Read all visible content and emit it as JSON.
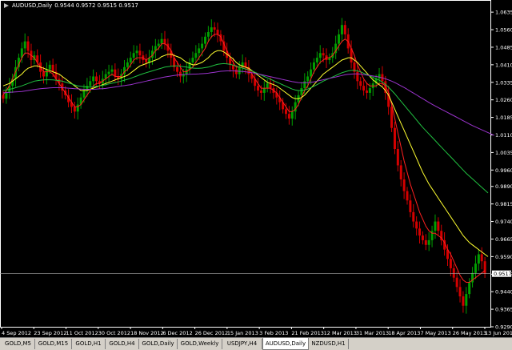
{
  "header": {
    "symbol": "AUDUSD,Daily",
    "ohlc": "0.9544 0.9572 0.9515 0.9517"
  },
  "colors": {
    "background": "#000000",
    "grid": "#4a4a4a",
    "axis": "#ffffff",
    "bull_candle": "#00a000",
    "bear_candle": "#d40000",
    "ma_fast": "#ff2020",
    "ma_mid": "#ffff30",
    "ma_slow": "#20c040",
    "ma_slowest": "#9a33cc",
    "price_line": "#aaaaaa"
  },
  "chart_data": {
    "type": "candlestick",
    "symbol": "AUDUSD",
    "timeframe": "Daily",
    "current_price": 0.9517,
    "current_price_label": "0.9517",
    "y_range": [
      0.929,
      1.068
    ],
    "y_ticks": [
      "1.0635",
      "1.0560",
      "1.0485",
      "1.0410",
      "1.0335",
      "1.0260",
      "1.0185",
      "1.0110",
      "1.0035",
      "0.9960",
      "0.9890",
      "0.9815",
      "0.9740",
      "0.9665",
      "0.9590",
      "0.9515",
      "0.9440",
      "0.9365",
      "0.9290"
    ],
    "x_ticks": [
      "4 Sep 2012",
      "23 Sep 2012",
      "11 Oct 2012",
      "30 Oct 2012",
      "18 Nov 2012",
      "6 Dec 2012",
      "26 Dec 2012",
      "15 Jan 2013",
      "3 Feb 2013",
      "21 Feb 2013",
      "12 Mar 2013",
      "31 Mar 2013",
      "18 Apr 2013",
      "7 May 2013",
      "26 May 2013",
      "13 Jun 2013"
    ],
    "closes": [
      1.0265,
      1.029,
      1.032,
      1.035,
      1.04,
      1.044,
      1.048,
      1.051,
      1.047,
      1.043,
      1.045,
      1.042,
      1.038,
      1.036,
      1.039,
      1.041,
      1.038,
      1.035,
      1.033,
      1.03,
      1.028,
      1.025,
      1.023,
      1.021,
      1.024,
      1.027,
      1.03,
      1.032,
      1.034,
      1.036,
      1.034,
      1.033,
      1.035,
      1.037,
      1.038,
      1.039,
      1.036,
      1.035,
      1.037,
      1.04,
      1.042,
      1.044,
      1.046,
      1.047,
      1.045,
      1.043,
      1.042,
      1.044,
      1.047,
      1.049,
      1.05,
      1.052,
      1.05,
      1.047,
      1.044,
      1.04,
      1.038,
      1.036,
      1.037,
      1.039,
      1.042,
      1.044,
      1.046,
      1.048,
      1.05,
      1.053,
      1.055,
      1.057,
      1.056,
      1.054,
      1.051,
      1.047,
      1.044,
      1.041,
      1.039,
      1.037,
      1.04,
      1.042,
      1.04,
      1.037,
      1.035,
      1.032,
      1.03,
      1.029,
      1.031,
      1.033,
      1.031,
      1.029,
      1.027,
      1.025,
      1.022,
      1.02,
      1.018,
      1.021,
      1.025,
      1.028,
      1.031,
      1.034,
      1.036,
      1.039,
      1.042,
      1.044,
      1.046,
      1.045,
      1.043,
      1.044,
      1.046,
      1.05,
      1.054,
      1.058,
      1.054,
      1.048,
      1.042,
      1.038,
      1.034,
      1.032,
      1.03,
      1.029,
      1.031,
      1.033,
      1.035,
      1.037,
      1.034,
      1.029,
      1.023,
      1.014,
      1.005,
      0.998,
      0.992,
      0.987,
      0.983,
      0.978,
      0.974,
      0.971,
      0.968,
      0.966,
      0.964,
      0.966,
      0.97,
      0.974,
      0.97,
      0.966,
      0.962,
      0.958,
      0.954,
      0.95,
      0.946,
      0.942,
      0.938,
      0.943,
      0.948,
      0.952,
      0.956,
      0.96,
      0.957,
      0.9517
    ],
    "series": [
      {
        "name": "MA fast",
        "values": [
          1.028,
          1.03,
          1.032,
          1.035,
          1.038,
          1.041,
          1.044,
          1.046,
          1.046,
          1.045,
          1.044,
          1.042,
          1.04,
          1.038,
          1.038,
          1.038,
          1.037,
          1.035,
          1.033,
          1.031,
          1.029,
          1.027,
          1.025,
          1.023,
          1.023,
          1.024,
          1.026,
          1.028,
          1.03,
          1.032,
          1.033,
          1.033,
          1.034,
          1.035,
          1.036,
          1.037,
          1.036,
          1.036,
          1.036,
          1.038,
          1.039,
          1.041,
          1.043,
          1.044,
          1.044,
          1.044,
          1.043,
          1.044,
          1.045,
          1.047,
          1.048,
          1.05,
          1.05,
          1.049,
          1.047,
          1.044,
          1.042,
          1.04,
          1.038,
          1.038,
          1.039,
          1.04,
          1.042,
          1.044,
          1.046,
          1.048,
          1.051,
          1.053,
          1.054,
          1.054,
          1.053,
          1.05,
          1.047,
          1.044,
          1.042,
          1.04,
          1.04,
          1.04,
          1.04,
          1.039,
          1.037,
          1.035,
          1.033,
          1.031,
          1.031,
          1.031,
          1.031,
          1.03,
          1.029,
          1.027,
          1.025,
          1.023,
          1.021,
          1.021,
          1.022,
          1.024,
          1.027,
          1.03,
          1.032,
          1.035,
          1.038,
          1.04,
          1.042,
          1.043,
          1.044,
          1.044,
          1.045,
          1.047,
          1.049,
          1.051,
          1.052,
          1.051,
          1.048,
          1.045,
          1.041,
          1.038,
          1.035,
          1.033,
          1.032,
          1.032,
          1.032,
          1.033,
          1.033,
          1.032,
          1.029,
          1.024,
          1.018,
          1.012,
          1.006,
          1.0,
          0.995,
          0.99,
          0.986,
          0.982,
          0.978,
          0.975,
          0.972,
          0.97,
          0.969,
          0.969,
          0.968,
          0.967,
          0.965,
          0.962,
          0.96,
          0.957,
          0.954,
          0.951,
          0.949,
          0.948,
          0.948,
          0.949,
          0.95,
          0.951,
          0.952,
          0.953
        ]
      },
      {
        "name": "MA mid",
        "values": [
          1.032,
          1.0325,
          1.033,
          1.034,
          1.035,
          1.036,
          1.037,
          1.0385,
          1.0395,
          1.04,
          1.0405,
          1.0405,
          1.04,
          1.0395,
          1.039,
          1.0385,
          1.038,
          1.0375,
          1.037,
          1.036,
          1.035,
          1.034,
          1.033,
          1.032,
          1.031,
          1.03,
          1.03,
          1.03,
          1.0305,
          1.031,
          1.0315,
          1.032,
          1.0325,
          1.033,
          1.0335,
          1.034,
          1.0345,
          1.035,
          1.0355,
          1.036,
          1.0365,
          1.0375,
          1.0385,
          1.0395,
          1.0405,
          1.041,
          1.0415,
          1.042,
          1.0425,
          1.043,
          1.0435,
          1.0445,
          1.045,
          1.0455,
          1.0455,
          1.045,
          1.0445,
          1.044,
          1.043,
          1.042,
          1.0415,
          1.041,
          1.041,
          1.0415,
          1.042,
          1.043,
          1.044,
          1.0455,
          1.0465,
          1.047,
          1.047,
          1.0465,
          1.0455,
          1.0445,
          1.0435,
          1.042,
          1.041,
          1.0405,
          1.04,
          1.0395,
          1.0385,
          1.0375,
          1.0365,
          1.0355,
          1.0345,
          1.0335,
          1.033,
          1.0325,
          1.032,
          1.031,
          1.03,
          1.029,
          1.028,
          1.027,
          1.0265,
          1.0265,
          1.027,
          1.028,
          1.0295,
          1.031,
          1.0325,
          1.034,
          1.0355,
          1.037,
          1.038,
          1.039,
          1.04,
          1.041,
          1.042,
          1.043,
          1.0435,
          1.044,
          1.044,
          1.043,
          1.042,
          1.0405,
          1.039,
          1.0375,
          1.036,
          1.0345,
          1.0335,
          1.0325,
          1.0315,
          1.03,
          1.028,
          1.025,
          1.022,
          1.019,
          1.016,
          1.013,
          1.01,
          1.007,
          1.004,
          1.001,
          0.998,
          0.995,
          0.9925,
          0.99,
          0.988,
          0.986,
          0.984,
          0.982,
          0.98,
          0.978,
          0.976,
          0.974,
          0.972,
          0.97,
          0.968,
          0.9665,
          0.965,
          0.964,
          0.963,
          0.962,
          0.961,
          0.96,
          0.959
        ]
      },
      {
        "name": "MA slow",
        "values": [
          1.03,
          1.0302,
          1.0305,
          1.0308,
          1.0312,
          1.0316,
          1.032,
          1.0325,
          1.033,
          1.0335,
          1.034,
          1.0342,
          1.0344,
          1.0345,
          1.0346,
          1.0346,
          1.0345,
          1.0344,
          1.0342,
          1.034,
          1.0336,
          1.0332,
          1.0328,
          1.0324,
          1.032,
          1.0318,
          1.0316,
          1.0315,
          1.0315,
          1.0316,
          1.0318,
          1.032,
          1.0322,
          1.0325,
          1.0328,
          1.0331,
          1.0334,
          1.0337,
          1.034,
          1.0344,
          1.0348,
          1.0352,
          1.0357,
          1.0362,
          1.0367,
          1.0372,
          1.0376,
          1.038,
          1.0384,
          1.0388,
          1.0392,
          1.0396,
          1.04,
          1.0402,
          1.0404,
          1.0405,
          1.0405,
          1.0404,
          1.0402,
          1.04,
          1.0398,
          1.0396,
          1.0395,
          1.0395,
          1.0396,
          1.0398,
          1.04,
          1.0404,
          1.0408,
          1.0412,
          1.0414,
          1.0415,
          1.0414,
          1.0412,
          1.0408,
          1.0404,
          1.04,
          1.0396,
          1.0392,
          1.0388,
          1.0384,
          1.0378,
          1.0372,
          1.0366,
          1.036,
          1.0354,
          1.0348,
          1.0342,
          1.0336,
          1.033,
          1.0324,
          1.0318,
          1.0312,
          1.0306,
          1.0302,
          1.03,
          1.03,
          1.0302,
          1.0306,
          1.0312,
          1.0318,
          1.0325,
          1.0332,
          1.034,
          1.0346,
          1.0352,
          1.0358,
          1.0364,
          1.037,
          1.0376,
          1.038,
          1.0384,
          1.0386,
          1.0386,
          1.0384,
          1.038,
          1.0374,
          1.0368,
          1.0362,
          1.0356,
          1.035,
          1.0344,
          1.0336,
          1.0326,
          1.0314,
          1.03,
          1.0286,
          1.027,
          1.0254,
          1.0238,
          1.0222,
          1.0206,
          1.019,
          1.0174,
          1.0158,
          1.0142,
          1.0128,
          1.0114,
          1.01,
          1.0086,
          1.0072,
          1.0058,
          1.0044,
          1.003,
          1.0016,
          1.0002,
          0.9988,
          0.9974,
          0.996,
          0.9946,
          0.9934,
          0.9922,
          0.991,
          0.9898,
          0.9886,
          0.9874,
          0.9862
        ]
      },
      {
        "name": "MA slowest",
        "values": [
          1.029,
          1.0291,
          1.0292,
          1.0293,
          1.0294,
          1.0295,
          1.0296,
          1.0298,
          1.03,
          1.0302,
          1.0304,
          1.0306,
          1.0308,
          1.0309,
          1.031,
          1.0311,
          1.0312,
          1.0312,
          1.0312,
          1.0312,
          1.0311,
          1.031,
          1.0309,
          1.0308,
          1.0307,
          1.0306,
          1.0305,
          1.0305,
          1.0305,
          1.0305,
          1.0306,
          1.0307,
          1.0308,
          1.0309,
          1.0311,
          1.0313,
          1.0315,
          1.0317,
          1.0319,
          1.0321,
          1.0323,
          1.0325,
          1.0328,
          1.0331,
          1.0334,
          1.0337,
          1.034,
          1.0343,
          1.0346,
          1.0349,
          1.0352,
          1.0355,
          1.0358,
          1.036,
          1.0362,
          1.0364,
          1.0366,
          1.0367,
          1.0368,
          1.0369,
          1.0369,
          1.037,
          1.037,
          1.0371,
          1.0372,
          1.0373,
          1.0374,
          1.0376,
          1.0378,
          1.038,
          1.0382,
          1.0383,
          1.0384,
          1.0384,
          1.0384,
          1.0383,
          1.0382,
          1.0381,
          1.038,
          1.0378,
          1.0376,
          1.0374,
          1.0371,
          1.0368,
          1.0365,
          1.0362,
          1.0359,
          1.0356,
          1.0353,
          1.035,
          1.0347,
          1.0344,
          1.0341,
          1.0338,
          1.0336,
          1.0334,
          1.0333,
          1.0333,
          1.0334,
          1.0335,
          1.0337,
          1.034,
          1.0343,
          1.0346,
          1.0349,
          1.0352,
          1.0355,
          1.0358,
          1.0361,
          1.0364,
          1.0367,
          1.0369,
          1.037,
          1.0371,
          1.0371,
          1.037,
          1.0368,
          1.0366,
          1.0364,
          1.0362,
          1.036,
          1.0357,
          1.0354,
          1.035,
          1.0345,
          1.034,
          1.0334,
          1.0327,
          1.032,
          1.0313,
          1.0305,
          1.0297,
          1.0289,
          1.0281,
          1.0273,
          1.0265,
          1.0257,
          1.0249,
          1.0241,
          1.0234,
          1.0227,
          1.022,
          1.0213,
          1.0206,
          1.0199,
          1.0192,
          1.0185,
          1.0178,
          1.0171,
          1.0164,
          1.0157,
          1.015,
          1.0144,
          1.0138,
          1.0132,
          1.0126,
          1.012,
          1.0114,
          1.0108
        ]
      }
    ]
  },
  "tabs": [
    {
      "label": "GOLD,M5",
      "active": false
    },
    {
      "label": "GOLD,M15",
      "active": false
    },
    {
      "label": "GOLD,H1",
      "active": false
    },
    {
      "label": "GOLD,H4",
      "active": false
    },
    {
      "label": "GOLD,Daily",
      "active": false
    },
    {
      "label": "GOLD,Weekly",
      "active": false
    },
    {
      "label": "USDJPY,H4",
      "active": false
    },
    {
      "label": "AUDUSD,Daily",
      "active": true
    },
    {
      "label": "NZDUSD,H1",
      "active": false
    }
  ]
}
